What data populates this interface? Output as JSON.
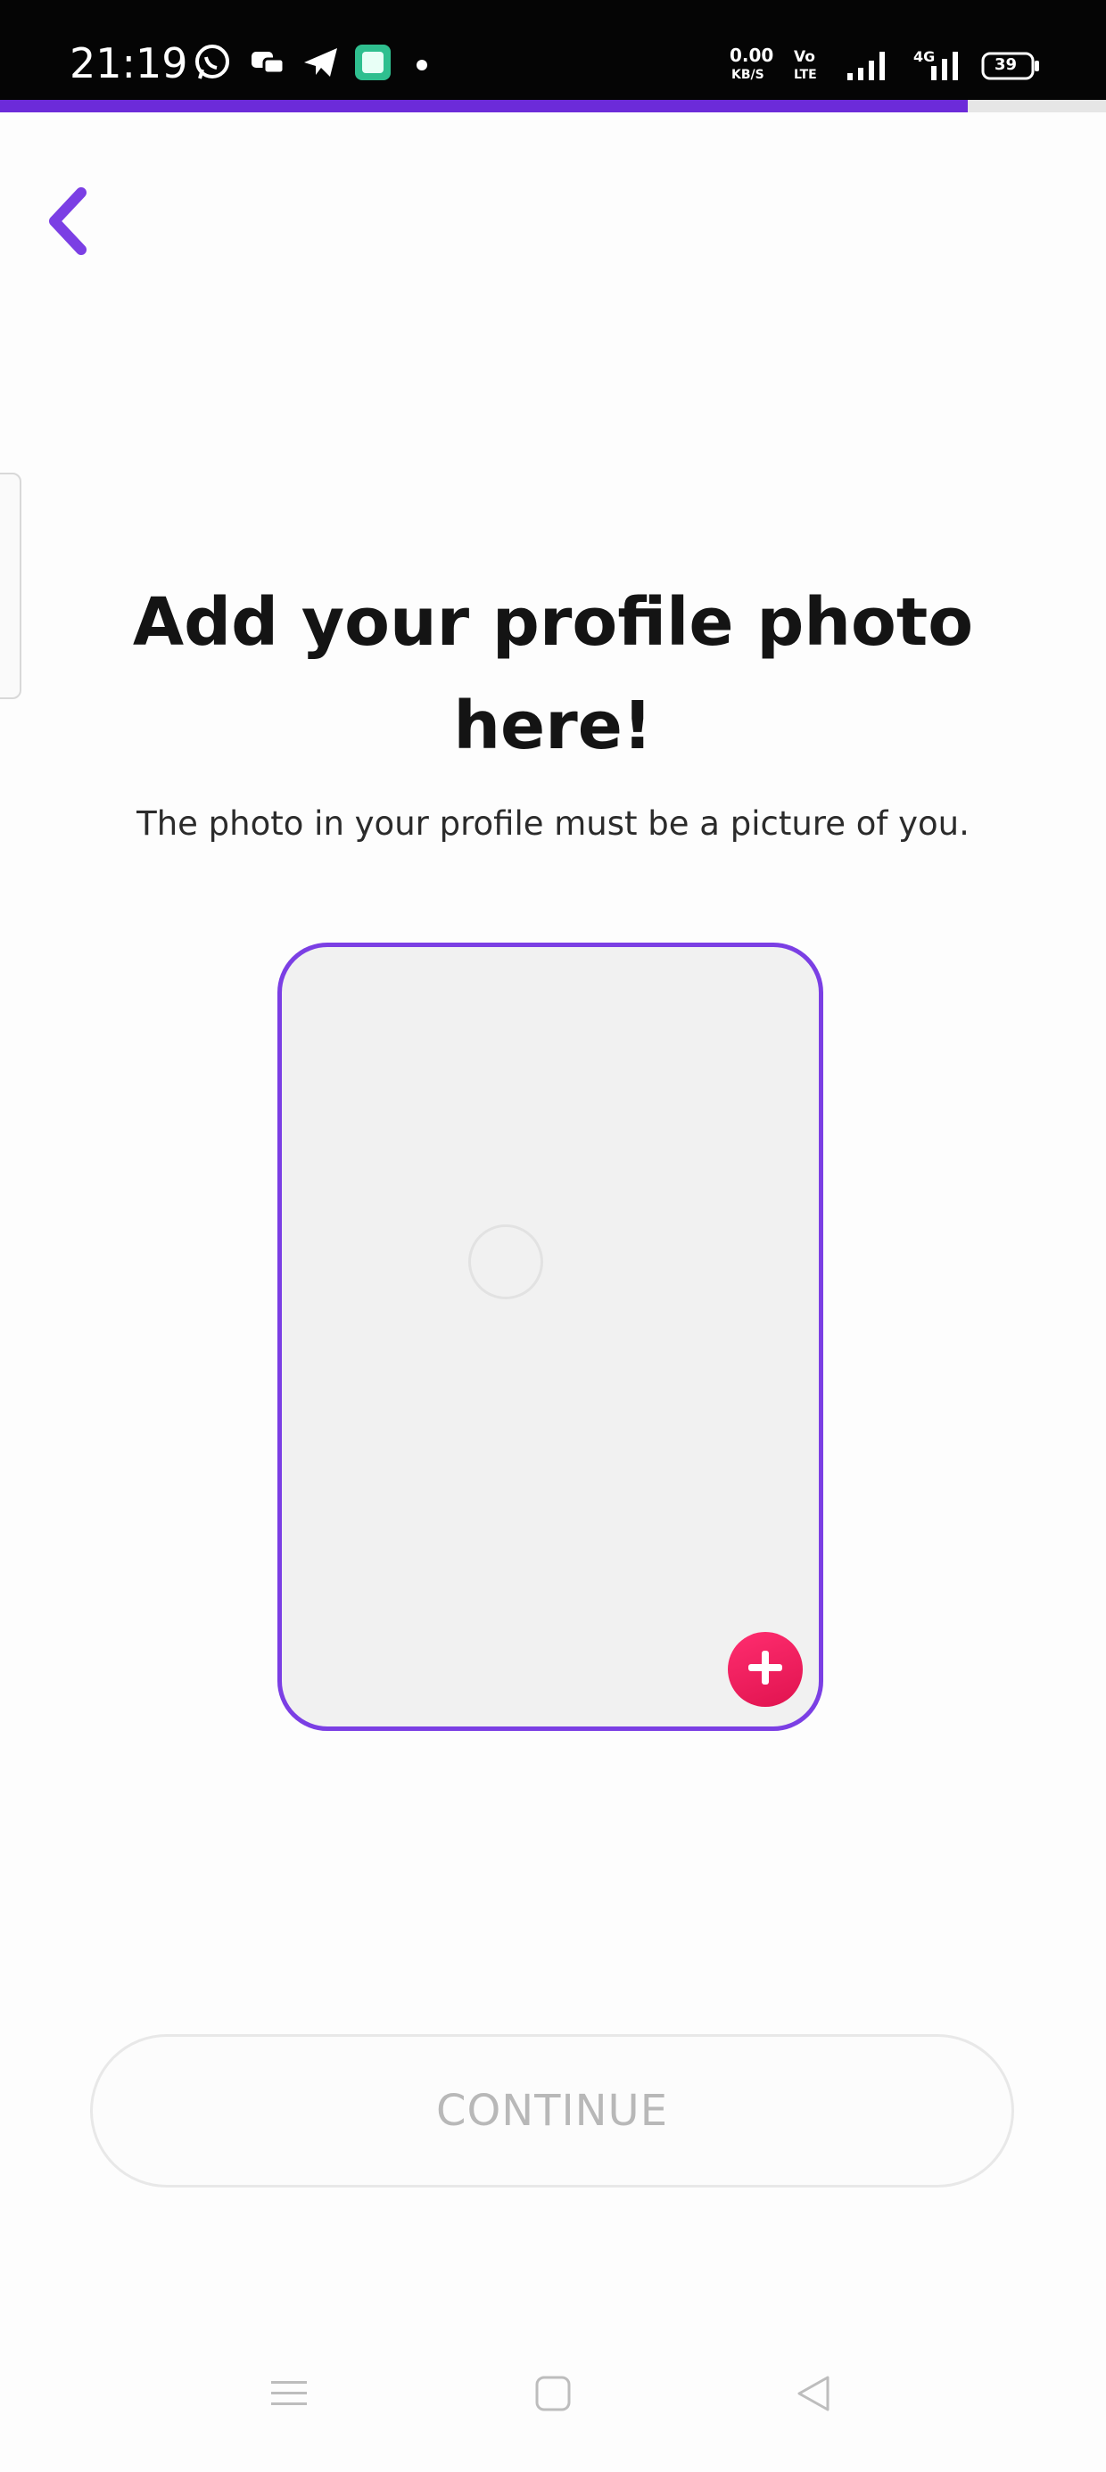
{
  "status_bar": {
    "time": "21:19",
    "left_icons": [
      "whatsapp-icon",
      "messenger-icon",
      "telegram-icon",
      "app-icon",
      "dot-icon"
    ],
    "network_speed_value": "0.00",
    "network_speed_unit": "KB/S",
    "volte_top": "Vo",
    "volte_bottom": "LTE",
    "signal_label": "4G",
    "battery_level": "39"
  },
  "progress": {
    "fraction": 0.875,
    "accent_color": "#6c2bd9"
  },
  "header": {
    "back_icon": "chevron-left-icon"
  },
  "main": {
    "title_line1": "Add your profile photo",
    "title_line2": "here!",
    "subtitle": "The photo in your profile must be a picture of you."
  },
  "photo_card": {
    "add_icon": "plus-icon",
    "border_color": "#7b3fe4",
    "add_color": "#f0205f"
  },
  "footer": {
    "continue_label": "CONTINUE"
  },
  "nav_bar": {
    "icons": [
      "menu-icon",
      "home-icon",
      "back-triangle-icon"
    ]
  }
}
